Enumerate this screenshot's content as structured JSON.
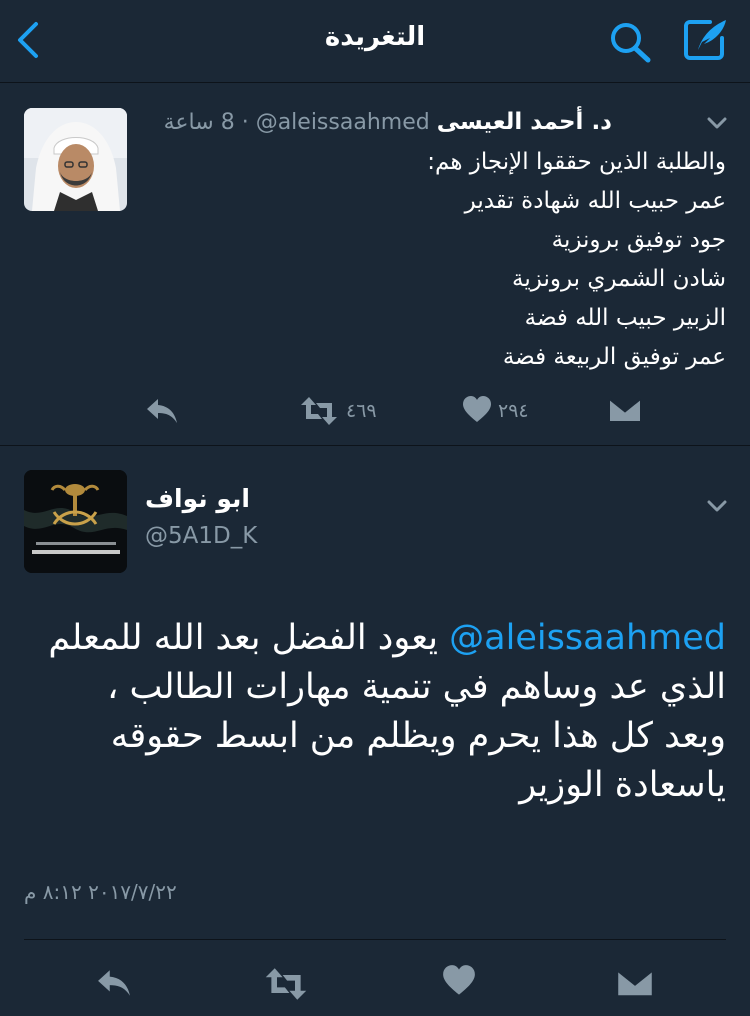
{
  "colors": {
    "background": "#141d26",
    "card": "#1b2836",
    "accent": "#1da1f2",
    "secondary_text": "#8899a6",
    "primary_text": "#ffffff"
  },
  "navbar": {
    "title": "التغريدة",
    "back_icon": "chevron-left-icon",
    "search_icon": "search-icon",
    "compose_icon": "compose-tweet-icon"
  },
  "tweet1": {
    "author_name": "د. أحمد العيسى",
    "handle": "@aleissaahmed",
    "separator": "·",
    "time": "8 ساعة",
    "lines": [
      "والطلبة الذين حققوا الإنجاز هم:",
      "عمر حبيب الله شهادة تقدير",
      "جود توفيق  برونزية",
      "شادن الشمري برونزية",
      "الزبير حبيب الله فضة",
      "عمر توفيق الربيعة فضة"
    ],
    "retweet_count": "٤٦٩",
    "like_count": "٢٩٤"
  },
  "tweet2": {
    "author_name": "ابو نواف",
    "handle": "@5A1D_K",
    "mention": "@aleissaahmed",
    "text_before_mention": "",
    "text_after_mention": " يعود الفضل بعد الله للمعلم الذي عد وساهم في تنمية مهارات الطالب ، وبعد كل هذا يحرم ويظلم من ابسط حقوقه ياسعادة الوزير",
    "date": "٢٠١٧/٧/٢٢ ٨:١٢ م"
  }
}
